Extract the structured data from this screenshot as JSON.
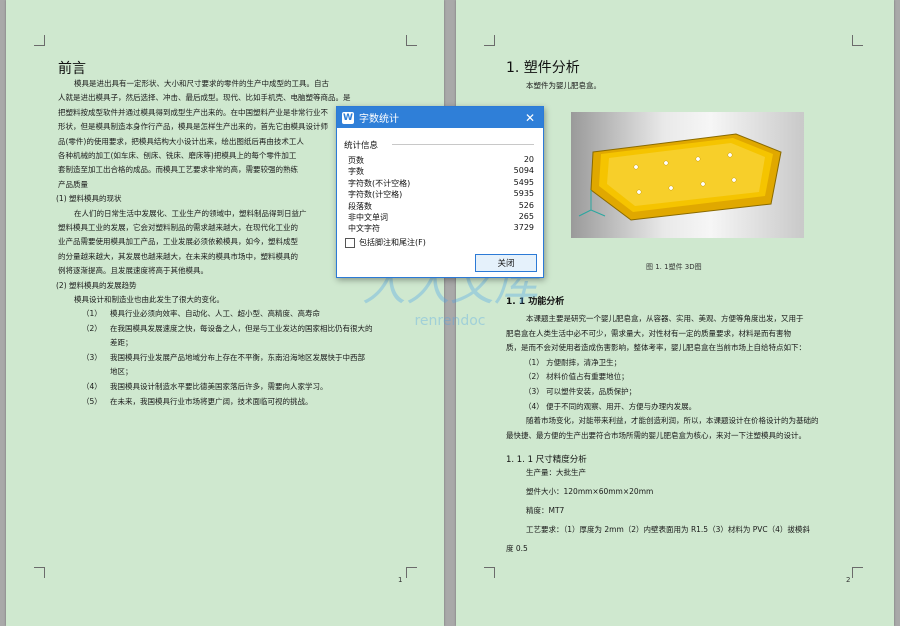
{
  "page1": {
    "heading": "前言",
    "lines": [
      "模具是进出具有一定形状、大小和尺寸要求的零件的生产中成型的工具。自古",
      "人就是进出模具子，然后选择、冲击、最后成型。现代、比如手机壳、电脑塑等商品。是",
      "把塑料按成型软件并通过模具得到成型生产出来的。在中国塑料产业是非常行业不",
      "形状，但是模具制造本身作行产品，模具是怎样生产出来的，首先它由模具设计师",
      "品(零件)的使用要求，把模具结构大小设计出来，绘出图纸后再由技术工人",
      "各种机械的加工(如车床、刨床、铣床、磨床等)把模具上的每个零件加工",
      "套制造至加工出合格的成品。而模具工艺要求非常的高，需要较强的熟练",
      "产品质量",
      "(1)  塑料模具的现状",
      "在人们的日常生活中发展化、工业生产的领域中，塑料制品得到日益广",
      "塑料模具工业的发展，它会对塑料制品的需求越来越大，在现代化工业的",
      "业产品需要使用模具加工产品，工业发展必须依赖模具，如今，塑料成型",
      "的分量越来越大，其发展也越来越大，在未来的模具市场中，塑料模具的",
      "例将逐渐提高。且发展速度将高于其他模具。",
      "(2) 塑料模具的发展趋势",
      "模具设计和制造业也由此发生了很大的变化。"
    ],
    "list": [
      {
        "num": "（1）",
        "text": "模具行业必须向效率、自动化、人工、超小型、高精度、高寿命"
      },
      {
        "num": "（2）",
        "text": "在我国模具发展速度之快，每设备之人，但是与工业发达的国家相比仍有很大的"
      },
      {
        "num": "",
        "text": "差距；"
      },
      {
        "num": "（3）",
        "text": "我国模具行业发展产品地域分布上存在不平衡，东南沿海地区发展快于中西部"
      },
      {
        "num": "",
        "text": "地区；"
      },
      {
        "num": "（4）",
        "text": "我国模具设计制造水平要比德美国家落后许多，需要向人家学习。"
      },
      {
        "num": "（5）",
        "text": "在未来，我国模具行业市场将更广阔，技术面临可视的挑战。"
      }
    ],
    "page_number": "1"
  },
  "page2": {
    "heading": "1. 塑件分析",
    "intro": "本塑件为婴儿肥皂盒。",
    "caption": "图 1. 1塑件 3D图",
    "section_1_1": "1. 1 功能分析",
    "section_lines": [
      "本课题主要是研究一个婴儿肥皂盒，从容器、实用、美观、方便等角度出发，又用于",
      "肥皂盒在人类生活中必不可少，需求量大，对性材有一定的质量要求，材料是而有害物",
      "质，是而不会对使用者造成伤害影响，整体考率，婴儿肥皂盒在当前市场上自给特点如下：",
      "（1） 方便耐摔，清净卫生；",
      "（2） 材料价值占有重要地位；",
      "（3） 可以塑件安装，品质保护；",
      "（4） 便于不同的观察、用开、方便与办理内发展。",
      "随着市场变化，对能带来利益，才能创造利润，所以，本课题设计在价格设计的为基础的",
      "最快捷、最方便的生产出要符合市场所需的婴儿肥皂盒为核心，来对一下注塑模具的设计。"
    ],
    "section_1_1_1": "1. 1. 1 尺寸精度分析",
    "specs": [
      "生产量：大批生产",
      "塑件大小：120mm×60mm×20mm",
      "精度：MT7",
      "工艺要求：（1）厚度为 2mm（2）内壁表面用为 R1.5（3）材料为 PVC（4）拔模斜",
      "度 0.5"
    ],
    "page_number": "2"
  },
  "dialog": {
    "title": "字数统计",
    "group_label": "统计信息",
    "rows": [
      {
        "label": "页数",
        "value": "20"
      },
      {
        "label": "字数",
        "value": "5094"
      },
      {
        "label": "字符数(不计空格)",
        "value": "5495"
      },
      {
        "label": "字符数(计空格)",
        "value": "5935"
      },
      {
        "label": "段落数",
        "value": "526"
      },
      {
        "label": "非中文单词",
        "value": "265"
      },
      {
        "label": "中文字符",
        "value": "3729"
      }
    ],
    "checkbox_label": "包括脚注和尾注(F)",
    "close_button": "关闭"
  },
  "watermark": {
    "text": "人人文库",
    "subtext": "renrendoc"
  },
  "colors": {
    "page_bg": "#cfe8cf",
    "titlebar": "#2f7fd8",
    "part_yellow": "#f5c400",
    "watermark": "#4aa3e8"
  }
}
